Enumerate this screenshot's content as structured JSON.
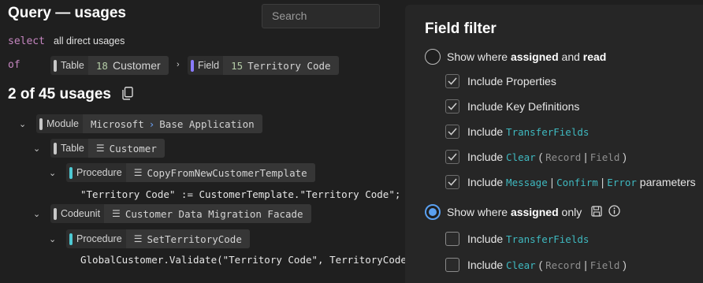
{
  "header": {
    "title": "Query — usages",
    "search_placeholder": "Search"
  },
  "query": {
    "select_kw": "select",
    "select_text": "all direct usages",
    "of_kw": "of",
    "table_chip": {
      "kind": "Table",
      "id": "18",
      "name": "Customer"
    },
    "field_chip": {
      "kind": "Field",
      "id": "15",
      "name": "Territory Code"
    }
  },
  "results": {
    "count_text": "2 of 45 usages",
    "module": {
      "kind": "Module",
      "publisher": "Microsoft",
      "sep": "›",
      "name": "Base Application"
    },
    "table": {
      "kind": "Table",
      "name": "Customer"
    },
    "proc1": {
      "kind": "Procedure",
      "name": "CopyFromNewCustomerTemplate"
    },
    "code1": "\"Territory Code\" := CustomerTemplate.\"Territory Code\";",
    "codeunit": {
      "kind": "Codeunit",
      "name": "Customer Data Migration Facade"
    },
    "proc2": {
      "kind": "Procedure",
      "name": "SetTerritoryCode"
    },
    "code2": "GlobalCustomer.Validate(\"Territory Code\", TerritoryCode)"
  },
  "filter": {
    "title": "Field filter",
    "opt1": {
      "pre": "Show where ",
      "b1": "assigned",
      "mid": " and ",
      "b2": "read"
    },
    "opt1_items": {
      "props": "Include Properties",
      "keys": "Include Key Definitions",
      "include": "Include ",
      "transfer": "TransferFields",
      "clear": "Clear",
      "record": "Record",
      "field": "Field",
      "message": "Message",
      "confirm": "Confirm",
      "error": "Error",
      "parameters": " parameters"
    },
    "opt2": {
      "pre": "Show where ",
      "b1": "assigned",
      "post": " only"
    },
    "paren_open": "(",
    "paren_close": ")",
    "pipe": "|"
  },
  "colors": {
    "accent": "#5aa0f0",
    "token": "#3fb9c0",
    "keyword": "#c586c0"
  }
}
